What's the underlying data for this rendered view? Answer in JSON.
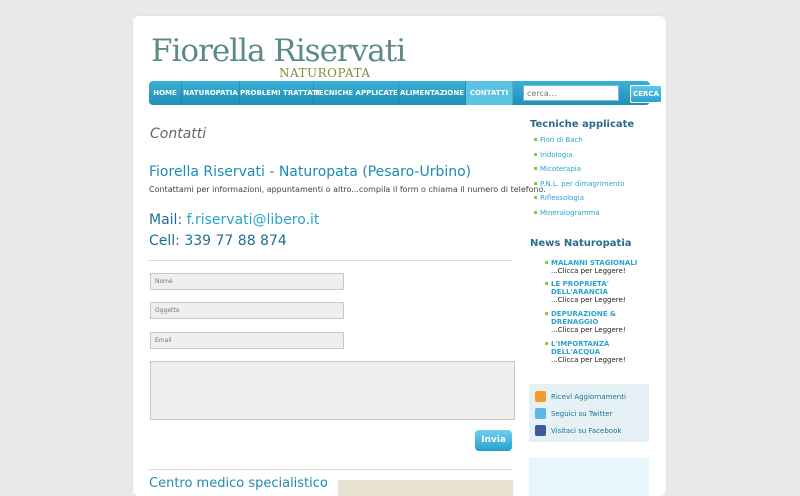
{
  "header": {
    "logo_name": "Fiorella Riservati",
    "logo_sub": "NATUROPATA"
  },
  "nav": {
    "items": [
      "HOME",
      "NATUROPATIA",
      "PROBLEMI TRATTATI",
      "TECNICHE APPLICATE",
      "ALIMENTAZIONE",
      "CONTATTI"
    ],
    "active": "CONTATTI",
    "search_placeholder": "cerca...",
    "search_button": "CERCA"
  },
  "main": {
    "page_title": "Contatti",
    "heading": "Fiorella Riservati - Naturopata (Pesaro-Urbino)",
    "intro": "Contattami per informazioni, appuntamenti o altro...compila il form o chiama il numero di telefono.",
    "mail_label": "Mail:",
    "mail_value": "f.riservati@libero.it",
    "cell_label": "Cell:",
    "cell_value": "339 77 88 874",
    "form": {
      "name_placeholder": "Nome",
      "subject_placeholder": "Oggetto",
      "email_placeholder": "Email",
      "send_label": "Invia"
    },
    "footer_heading": "Centro medico specialistico"
  },
  "sidebar": {
    "tecniche_title": "Tecniche applicate",
    "tecniche": [
      "Fiori di Bach",
      "Iridologia",
      "Micoterapia",
      "P.N.L. per dimagrimento",
      "Riflessologia",
      "Mineralogramma"
    ],
    "news_title": "News Naturopatia",
    "news": [
      {
        "title": [
          "MALANNI STAGIONALI"
        ],
        "more": "...Clicca per Leggere!"
      },
      {
        "title": [
          "LE PROPRIETA'",
          "DELL'ARANCIA"
        ],
        "more": "...Clicca per Leggere!"
      },
      {
        "title": [
          "DEPURAZIONE &",
          "DRENAGGIO"
        ],
        "more": "...Clicca per Leggere!"
      },
      {
        "title": [
          "L'IMPORTANZA",
          "DELL'ACQUA"
        ],
        "more": "...Clicca per Leggere!"
      }
    ],
    "social": [
      {
        "label": "Ricevi Aggiornamenti",
        "icon": "rss-icon",
        "color": "#f39c2b"
      },
      {
        "label": "Seguici su Twitter",
        "icon": "twitter-icon",
        "color": "#5ab7e6"
      },
      {
        "label": "Visitaci su Facebook",
        "icon": "facebook-icon",
        "color": "#3b5b9a"
      }
    ]
  }
}
